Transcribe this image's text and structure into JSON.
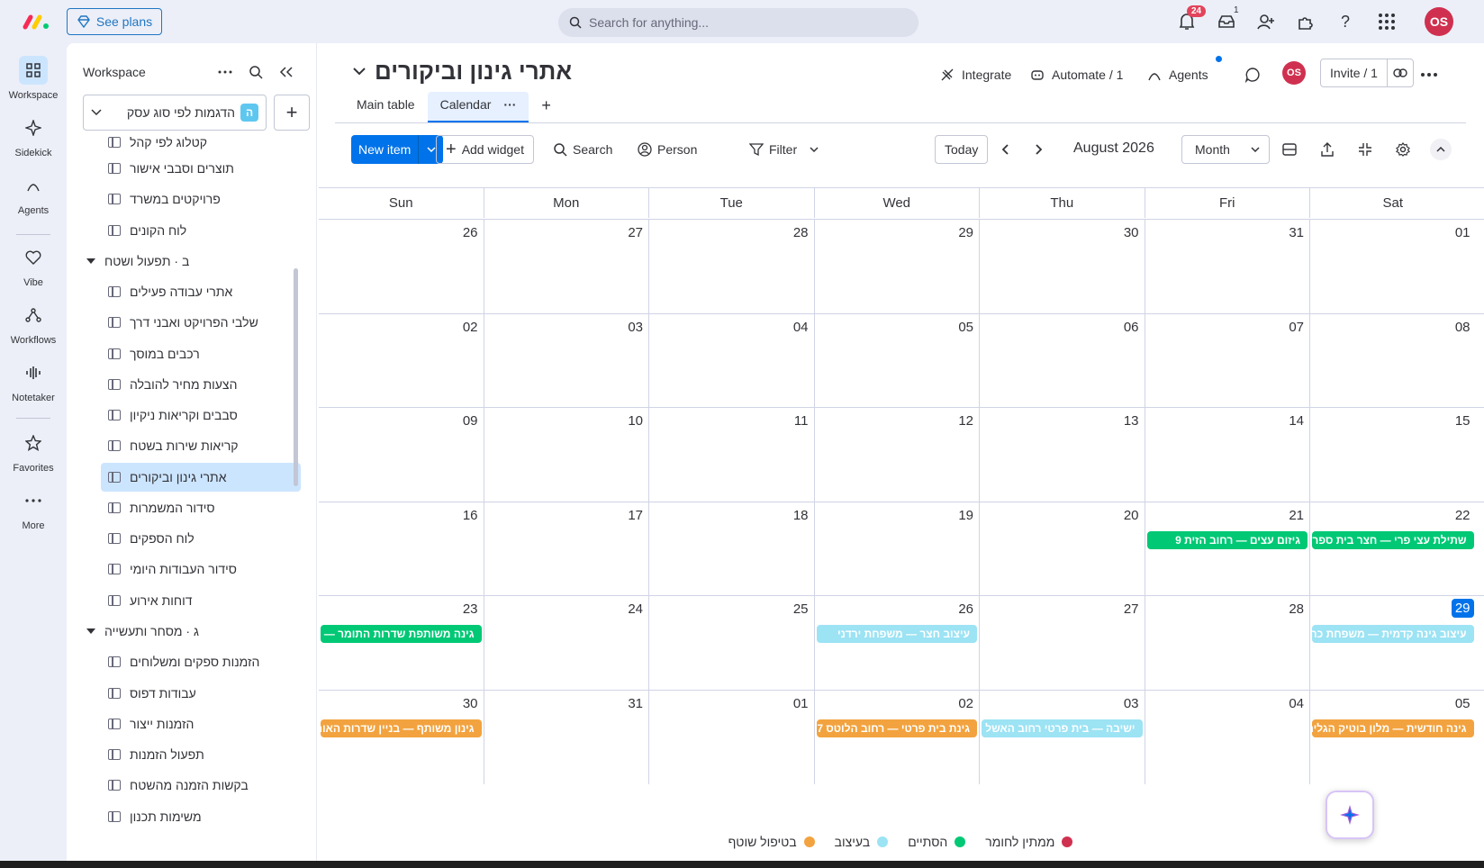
{
  "topbar": {
    "see_plans": "See plans",
    "search_placeholder": "Search for anything...",
    "notifications_count": "24",
    "inbox_count": "1",
    "avatar_initials": "OS"
  },
  "rail": {
    "items": [
      {
        "label": "Workspace",
        "icon": "grid-icon"
      },
      {
        "label": "Sidekick",
        "icon": "sparkle-icon"
      },
      {
        "label": "Agents",
        "icon": "agents-icon"
      },
      {
        "label": "Vibe",
        "icon": "heart-icon"
      },
      {
        "label": "Workflows",
        "icon": "workflow-icon"
      },
      {
        "label": "Notetaker",
        "icon": "waveform-icon"
      },
      {
        "label": "Favorites",
        "icon": "star-icon"
      },
      {
        "label": "More",
        "icon": "more-icon"
      }
    ]
  },
  "sidebar": {
    "title": "Workspace",
    "workspace_name": "הדגמות לפי סוג עסק",
    "workspace_badge": "ה",
    "items": [
      "קטלוג לפי קהל",
      "תוצרים וסבבי אישור",
      "פרויקטים במשרד",
      "לוח הקונים",
      "ב · תפעול ושטח",
      "אתרי עבודה פעילים",
      "שלבי הפרויקט ואבני דרך",
      "רכבים במוסך",
      "הצעות מחיר להובלה",
      "סבבים וקריאות ניקיון",
      "קריאות שירות בשטח",
      "אתרי גינון וביקורים",
      "סידור המשמרות",
      "לוח הספקים",
      "סידור העבודות היומי",
      "דוחות אירוע",
      "ג · מסחר ותעשייה",
      "הזמנות ספקים ומשלוחים",
      "עבודות דפוס",
      "הזמנות ייצור",
      "תפעול הזמנות",
      "בקשות הזמנה מהשטח",
      "משימות תכנון"
    ]
  },
  "board": {
    "title": "אתרי גינון וביקורים",
    "integrate": "Integrate",
    "automate": "Automate / 1",
    "agents": "Agents",
    "avatar": "OS",
    "invite": "Invite / 1",
    "tabs": [
      "Main table",
      "Calendar"
    ]
  },
  "toolbar": {
    "new_item": "New item",
    "add_widget": "Add widget",
    "search": "Search",
    "person": "Person",
    "filter": "Filter",
    "today": "Today",
    "month_label": "August 2026",
    "view_select": "Month"
  },
  "calendar": {
    "weekdays": [
      "Sun",
      "Mon",
      "Tue",
      "Wed",
      "Thu",
      "Fri",
      "Sat"
    ],
    "weeks": [
      [
        "26",
        "27",
        "28",
        "29",
        "30",
        "31",
        "01"
      ],
      [
        "02",
        "03",
        "04",
        "05",
        "06",
        "07",
        "08"
      ],
      [
        "09",
        "10",
        "11",
        "12",
        "13",
        "14",
        "15"
      ],
      [
        "16",
        "17",
        "18",
        "19",
        "20",
        "21",
        "22"
      ],
      [
        "23",
        "24",
        "25",
        "26",
        "27",
        "28",
        "29"
      ],
      [
        "30",
        "31",
        "01",
        "02",
        "03",
        "04",
        "05"
      ]
    ],
    "today_cell": "29",
    "events": [
      {
        "week": 3,
        "day": 5,
        "text": "גיזום עצים — רחוב הזית 9",
        "color": "#00c875"
      },
      {
        "week": 3,
        "day": 6,
        "text": "שתילת עצי פרי — חצר בית ספר",
        "color": "#00c875"
      },
      {
        "week": 4,
        "day": 0,
        "text": "גינה משותפת שדרות התומר —",
        "color": "#00c875"
      },
      {
        "week": 4,
        "day": 3,
        "text": "עיצוב חצר — משפחת ירדני",
        "color": "#9ce3f4"
      },
      {
        "week": 4,
        "day": 6,
        "text": "עיצוב גינה קדמית — משפחת כהן",
        "color": "#9ce3f4"
      },
      {
        "week": 5,
        "day": 0,
        "text": "גינון משותף — בניין שדרות האורן",
        "color": "#f2a33f"
      },
      {
        "week": 5,
        "day": 3,
        "text": "גינת בית פרטי — רחוב הלוטס 7",
        "color": "#f2a33f"
      },
      {
        "week": 5,
        "day": 4,
        "text": "ישיבה — בית פרטי רחוב האשל",
        "color": "#9ce3f4"
      },
      {
        "week": 5,
        "day": 6,
        "text": "גינה חודשית — מלון בוטיק הגלים",
        "color": "#f2a33f"
      }
    ]
  },
  "legend": [
    {
      "label": "ממתין לחומר",
      "color": "#d0304f"
    },
    {
      "label": "הסתיים",
      "color": "#00c875"
    },
    {
      "label": "בעיצוב",
      "color": "#9ce3f4"
    },
    {
      "label": "בטיפול שוטף",
      "color": "#f2a33f"
    }
  ]
}
